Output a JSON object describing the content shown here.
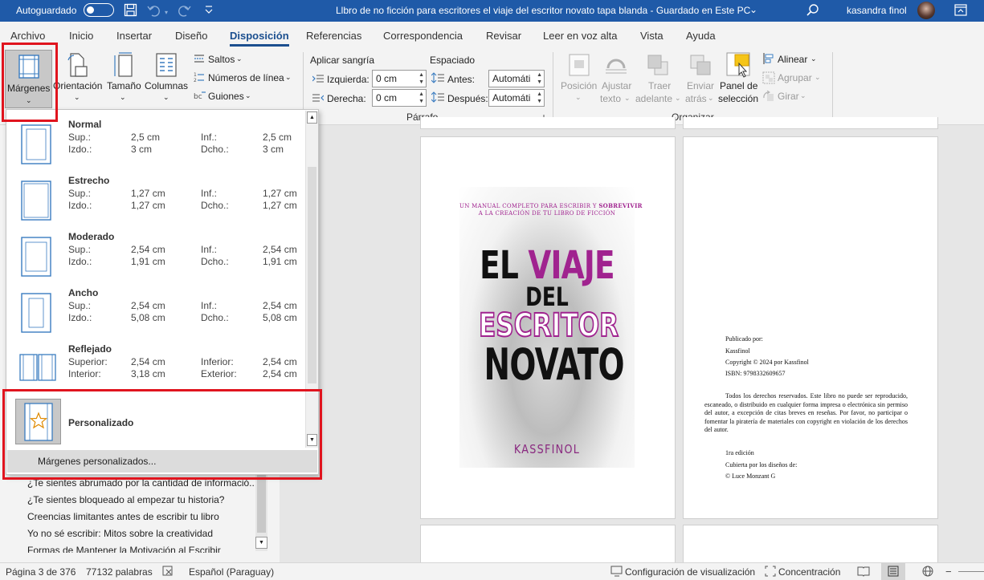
{
  "titlebar": {
    "autosave_label": "Autoguardado",
    "doc_title": "Llbro de no ficción para escritores el viaje del escritor novato tapa blanda  -  Guardado en Este PC",
    "doc_title_arrow": "⌄",
    "user_name": "kasandra finol"
  },
  "tabs": [
    "Archivo",
    "Inicio",
    "Insertar",
    "Diseño",
    "Disposición",
    "Referencias",
    "Correspondencia",
    "Revisar",
    "Leer en voz alta",
    "Vista",
    "Ayuda"
  ],
  "ribbon": {
    "margins_label": "Márgenes",
    "orientation_label": "Orientación",
    "size_label": "Tamaño",
    "columns_label": "Columnas",
    "breaks_label": "Saltos",
    "line_numbers_label": "Números de línea",
    "hyphenation_label": "Guiones",
    "indent_title": "Aplicar sangría",
    "indent_left_label": "Izquierda:",
    "indent_left_value": "0 cm",
    "indent_right_label": "Derecha:",
    "indent_right_value": "0 cm",
    "spacing_title": "Espaciado",
    "spacing_before_label": "Antes:",
    "spacing_before_value": "Automáti",
    "spacing_after_label": "Después:",
    "spacing_after_value": "Automáti",
    "paragraph_group": "Párrafo",
    "position_label": "Posición",
    "wrap_label_1": "Ajustar",
    "wrap_label_2": "texto",
    "forward_label_1": "Traer",
    "forward_label_2": "adelante",
    "backward_label_1": "Enviar",
    "backward_label_2": "atrás",
    "selection_label_1": "Panel de",
    "selection_label_2": "selección",
    "align_label": "Alinear",
    "group_label": "Agrupar",
    "rotate_label": "Girar",
    "arrange_group": "Organizar"
  },
  "margins_menu": {
    "options": [
      {
        "name": "Normal",
        "l1": "Sup.:",
        "v1": "2,5 cm",
        "l2": "Inf.:",
        "v2": "2,5 cm",
        "l3": "Izdo.:",
        "v3": "3 cm",
        "l4": "Dcho.:",
        "v4": "3 cm"
      },
      {
        "name": "Estrecho",
        "l1": "Sup.:",
        "v1": "1,27 cm",
        "l2": "Inf.:",
        "v2": "1,27 cm",
        "l3": "Izdo.:",
        "v3": "1,27 cm",
        "l4": "Dcho.:",
        "v4": "1,27 cm"
      },
      {
        "name": "Moderado",
        "l1": "Sup.:",
        "v1": "2,54 cm",
        "l2": "Inf.:",
        "v2": "2,54 cm",
        "l3": "Izdo.:",
        "v3": "1,91 cm",
        "l4": "Dcho.:",
        "v4": "1,91 cm"
      },
      {
        "name": "Ancho",
        "l1": "Sup.:",
        "v1": "2,54 cm",
        "l2": "Inf.:",
        "v2": "2,54 cm",
        "l3": "Izdo.:",
        "v3": "5,08 cm",
        "l4": "Dcho.:",
        "v4": "5,08 cm"
      },
      {
        "name": "Reflejado",
        "l1": "Superior:",
        "v1": "2,54 cm",
        "l2": "Inferior:",
        "v2": "2,54 cm",
        "l3": "Interior:",
        "v3": "3,18 cm",
        "l4": "Exterior:",
        "v4": "2,54 cm"
      }
    ],
    "custom_name": "Personalizado",
    "custom_margins_link": "Márgenes personalizados..."
  },
  "nav_items": [
    "¿Te sientes abrumado por la cantidad de informació...",
    "¿Te sientes bloqueado al empezar tu historia?",
    "Creencias limitantes antes de escribir tu libro",
    "Yo no sé escribir: Mitos sobre la creatividad",
    "Formas de Mantener la Motivación al Escribir"
  ],
  "cover": {
    "tagline_1": "UN MANUAL COMPLETO PARA ESCRIBIR Y",
    "tagline_bold": "SOBREVIVIR",
    "tagline_2": "A LA CREACIÓN DE TU LIBRO DE FICCIÓN",
    "title_el": "EL",
    "title_viaje": "VIAJE",
    "title_del": "DEL",
    "title_escritor": "ESCRITOR",
    "title_novato": "NOVATO",
    "author": "KASSFINOL"
  },
  "copyright_page": {
    "published_by_label": "Publicado por:",
    "publisher": "Kassfinol",
    "copyright": "Copyright © 2024 por Kassfinol",
    "isbn": "ISBN: 9798332609657",
    "rights": "Todos los derechos reservados. Este libro no puede ser reproducido, escaneado, o distribuido en cualquier forma impresa o electrónica sin permiso del autor, a excepción de citas breves en reseñas. Por favor, no participar o fomentar la piratería de materiales con copyright en violación de los derechos del autor.",
    "edition": "1ra edición",
    "cover_by": "Cubierta por los diseños de:",
    "designer": "© Luce Monzant G"
  },
  "statusbar": {
    "page": "Página 3 de 376",
    "words": "77132 palabras",
    "language": "Español (Paraguay)",
    "display_settings": "Configuración de visualización",
    "focus": "Concentración"
  },
  "colors": {
    "accent": "#1f5aa8",
    "highlight": "#e0141e",
    "cover_purple": "#a0238f"
  }
}
